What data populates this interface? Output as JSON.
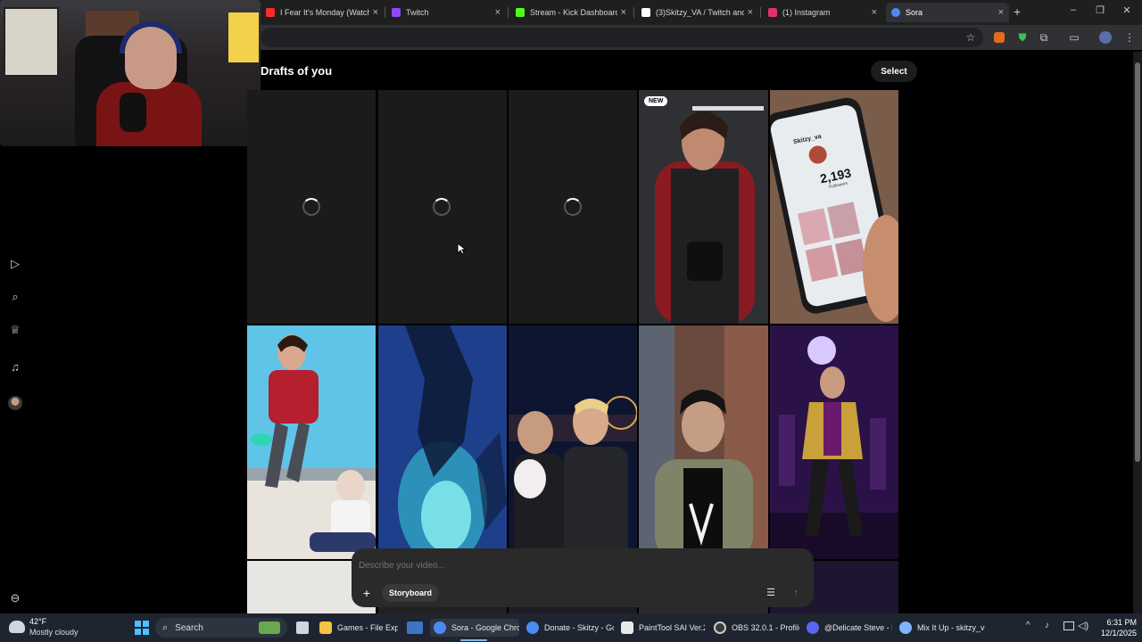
{
  "browser": {
    "tabs": [
      {
        "title": "I Fear It's Monday (Watch",
        "favicon_color": "#ff2a2a",
        "active": false
      },
      {
        "title": "Twitch",
        "favicon_color": "#9146ff",
        "active": false
      },
      {
        "title": "Stream - Kick Dashboard",
        "favicon_color": "#53fc18",
        "active": false
      },
      {
        "title": "(3)Skitzy_VA / Twitch and",
        "favicon_color": "#ffffff",
        "active": false
      },
      {
        "title": "(1) Instagram",
        "favicon_color": "#e1306c",
        "active": false
      },
      {
        "title": "Sora",
        "favicon_color": "#4c8bf5",
        "active": true
      }
    ],
    "new_tab_icon": "plus-icon",
    "window_controls": [
      "minimize-icon",
      "restore-icon",
      "close-icon"
    ]
  },
  "sidebar": {
    "icons": [
      "video-icon",
      "search-icon",
      "trophy-icon",
      "bell-icon",
      "avatar",
      "settings-icon"
    ]
  },
  "main": {
    "title": "Drafts of you",
    "select_label": "Select",
    "new_badge": "NEW",
    "phone_username": "Skitzy_va",
    "phone_count": "2,193",
    "phone_count_label": "Followers"
  },
  "composer": {
    "placeholder": "Describe your video...",
    "storyboard_label": "Storyboard"
  },
  "taskbar": {
    "weather_temp": "42°F",
    "weather_condition": "Mostly cloudy",
    "search_label": "Search",
    "apps": [
      {
        "label": "Games - File Explo",
        "color": "#f4c542"
      },
      {
        "label": "Sora - Google Chro",
        "color": "#4c8bf5",
        "active": true
      },
      {
        "label": "Donate - Skitzy - Go",
        "color": "#4c8bf5"
      },
      {
        "label": "PaintTool SAI Ver.2",
        "color": "#e8e8e8"
      },
      {
        "label": "OBS 32.0.1 - Profile:",
        "color": "#3a3a3a"
      },
      {
        "label": "@Delicate Steve - D",
        "color": "#5865f2"
      },
      {
        "label": "Mix It Up - skitzy_va",
        "color": "#7fb3ff"
      }
    ],
    "time": "6:31 PM",
    "date": "12/1/2025"
  }
}
